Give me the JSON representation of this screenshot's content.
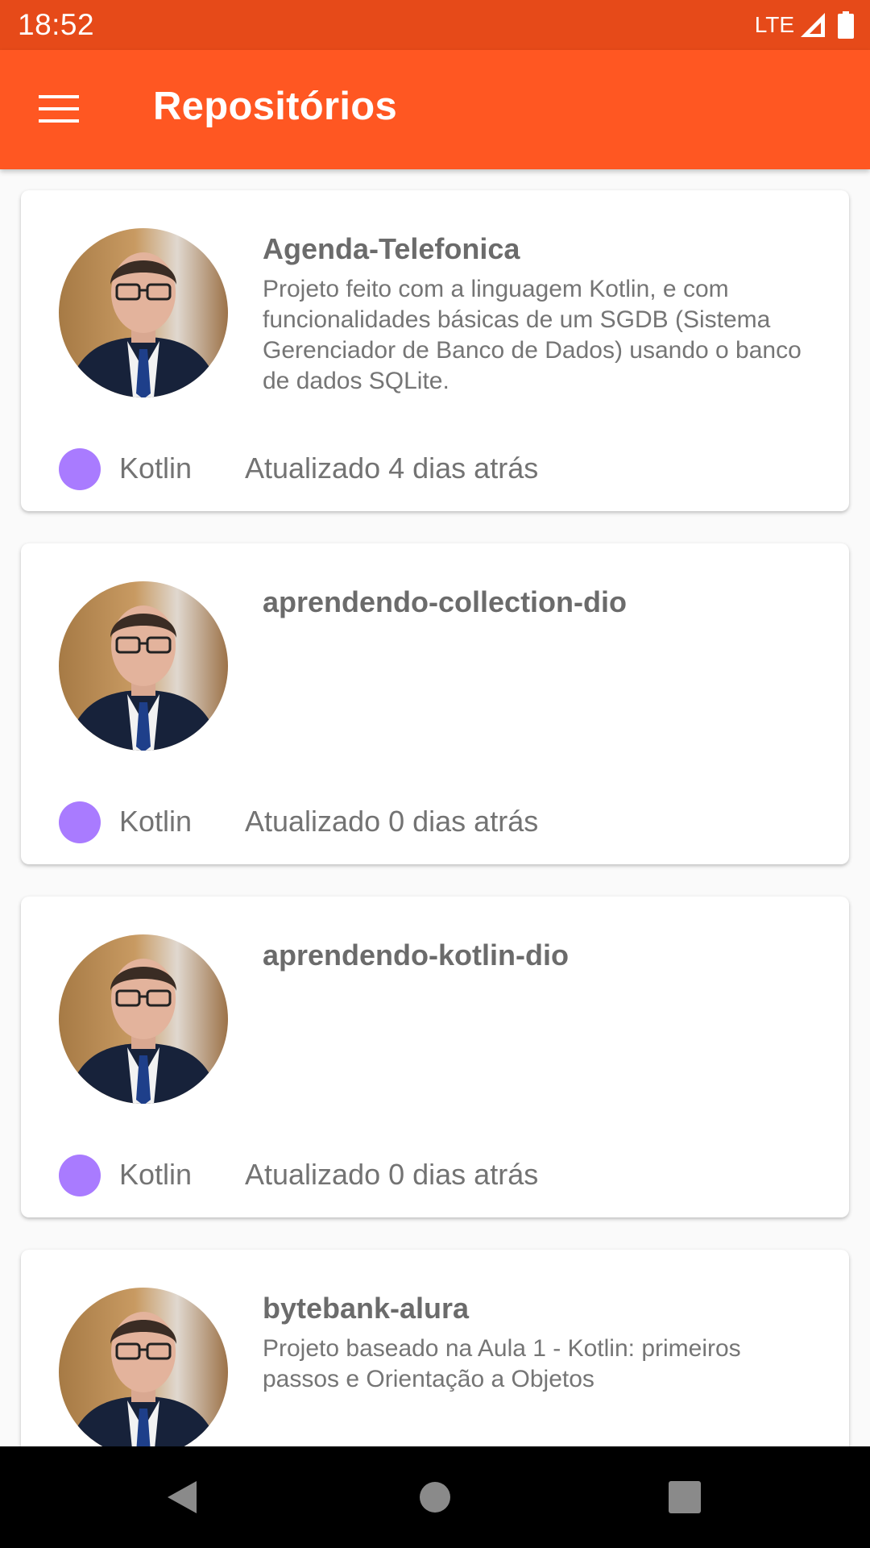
{
  "status_bar": {
    "time": "18:52",
    "network": "LTE"
  },
  "app_bar": {
    "title": "Repositórios",
    "menu_icon": "hamburger-menu-icon"
  },
  "repositories": [
    {
      "name": "Agenda-Telefonica",
      "description": "Projeto feito com a linguagem Kotlin, e com funcionalidades básicas de um SGDB (Sistema Gerenciador de Banco de Dados) usando o banco de dados SQLite.",
      "language": "Kotlin",
      "updated": "Atualizado 4 dias atrás"
    },
    {
      "name": "aprendendo-collection-dio",
      "description": "",
      "language": "Kotlin",
      "updated": "Atualizado 0 dias atrás"
    },
    {
      "name": "aprendendo-kotlin-dio",
      "description": "",
      "language": "Kotlin",
      "updated": "Atualizado 0 dias atrás"
    },
    {
      "name": "bytebank-alura",
      "description": "Projeto baseado na Aula 1 - Kotlin: primeiros passos e Orientação a Objetos",
      "language": "",
      "updated": ""
    }
  ],
  "colors": {
    "status_bar": "#e64a19",
    "app_bar": "#ff5722",
    "kotlin_language": "#a97bff"
  },
  "nav_bar": {
    "icons": [
      "back-icon",
      "home-icon",
      "recent-apps-icon"
    ]
  }
}
